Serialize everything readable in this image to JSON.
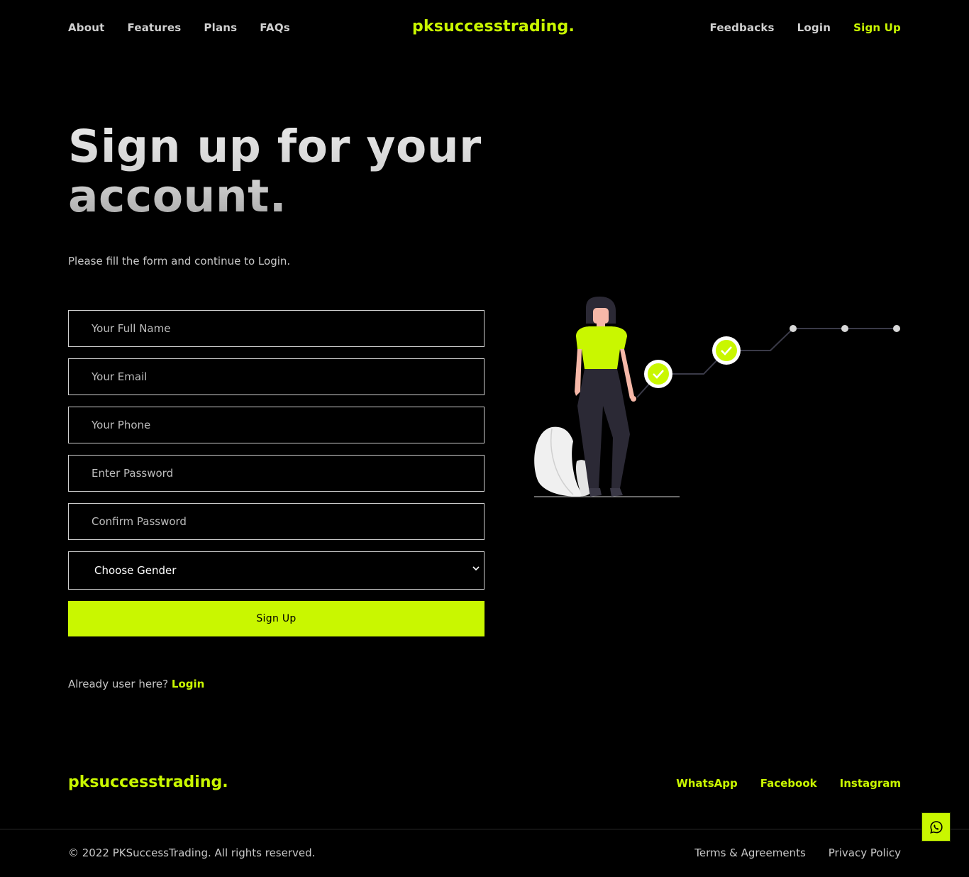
{
  "nav": {
    "left": [
      "About",
      "Features",
      "Plans",
      "FAQs"
    ],
    "brand": "pksuccesstrading.",
    "right": {
      "feedbacks": "Feedbacks",
      "login": "Login",
      "signup": "Sign Up"
    }
  },
  "hero": {
    "title_line1": "Sign up for your",
    "title_line2": "account.",
    "subtitle": "Please fill the form and continue to Login."
  },
  "form": {
    "full_name_placeholder": "Your Full Name",
    "email_placeholder": "Your Email",
    "phone_placeholder": "Your Phone",
    "password_placeholder": "Enter Password",
    "confirm_password_placeholder": "Confirm Password",
    "gender_selected": "Choose Gender",
    "submit_label": "Sign Up"
  },
  "login_prompt": {
    "text": "Already user here?",
    "link": "Login"
  },
  "footer": {
    "brand": "pksuccesstrading.",
    "social": [
      "WhatsApp",
      "Facebook",
      "Instagram"
    ],
    "copyright": "© 2022 PKSuccessTrading. All rights reserved.",
    "legal": [
      "Terms & Agreements",
      "Privacy Policy"
    ]
  },
  "colors": {
    "accent": "#c9f700",
    "background": "#000000",
    "text_muted": "#c8c8c8"
  },
  "icons": {
    "floating_button": "whatsapp-icon",
    "select": "chevron-down-icon"
  }
}
